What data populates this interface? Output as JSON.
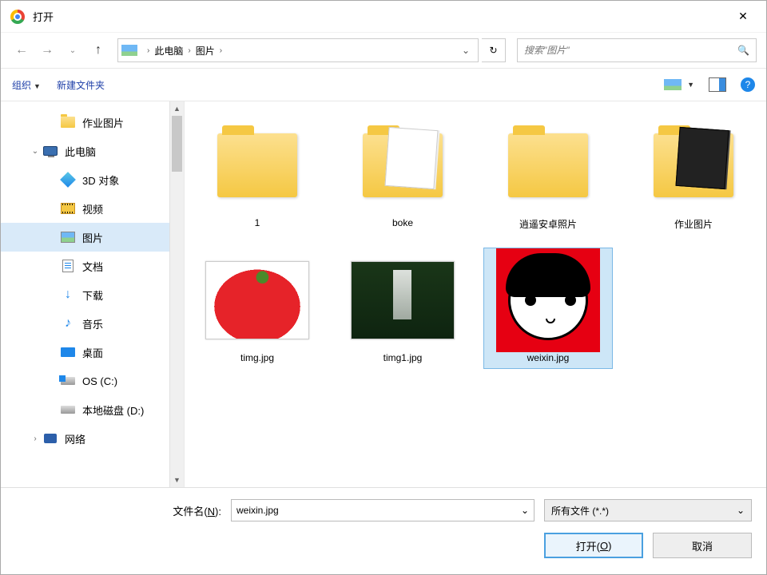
{
  "titlebar": {
    "title": "打开"
  },
  "nav": {
    "breadcrumbs": [
      "此电脑",
      "图片"
    ],
    "search_placeholder": "搜索\"图片\""
  },
  "toolbar": {
    "organize": "组织",
    "new_folder": "新建文件夹"
  },
  "sidebar": {
    "items": [
      {
        "key": "homework-pics",
        "label": "作业图片",
        "icon": "folder",
        "level": 2
      },
      {
        "key": "this-pc",
        "label": "此电脑",
        "icon": "pc",
        "level": 1,
        "expanded": true
      },
      {
        "key": "3d-objects",
        "label": "3D 对象",
        "icon": "cube",
        "level": 2
      },
      {
        "key": "videos",
        "label": "视频",
        "icon": "video",
        "level": 2
      },
      {
        "key": "pictures",
        "label": "图片",
        "icon": "pic",
        "level": 2,
        "selected": true
      },
      {
        "key": "documents",
        "label": "文档",
        "icon": "doc",
        "level": 2
      },
      {
        "key": "downloads",
        "label": "下载",
        "icon": "down",
        "level": 2
      },
      {
        "key": "music",
        "label": "音乐",
        "icon": "music",
        "level": 2
      },
      {
        "key": "desktop",
        "label": "桌面",
        "icon": "desk",
        "level": 2
      },
      {
        "key": "drive-c",
        "label": "OS (C:)",
        "icon": "drive-os",
        "level": 2
      },
      {
        "key": "drive-d",
        "label": "本地磁盘 (D:)",
        "icon": "drive",
        "level": 2
      },
      {
        "key": "network",
        "label": "网络",
        "icon": "net",
        "level": 1,
        "expandable": true
      }
    ]
  },
  "content": {
    "items": [
      {
        "name": "1",
        "type": "folder",
        "variant": ""
      },
      {
        "name": "boke",
        "type": "folder",
        "variant": "boke"
      },
      {
        "name": "逍遥安卓照片",
        "type": "folder",
        "variant": ""
      },
      {
        "name": "作业图片",
        "type": "folder",
        "variant": "xy"
      },
      {
        "name": "timg.jpg",
        "type": "image",
        "variant": "strawberry"
      },
      {
        "name": "timg1.jpg",
        "type": "image",
        "variant": "waterfall"
      },
      {
        "name": "weixin.jpg",
        "type": "image",
        "variant": "weixin",
        "selected": true
      }
    ]
  },
  "footer": {
    "filename_label_pre": "文件名(",
    "filename_label_u": "N",
    "filename_label_post": "):",
    "filename_value": "weixin.jpg",
    "filter_label": "所有文件 (*.*)",
    "open_label_pre": "打开(",
    "open_label_u": "O",
    "open_label_post": ")",
    "cancel_label": "取消"
  }
}
